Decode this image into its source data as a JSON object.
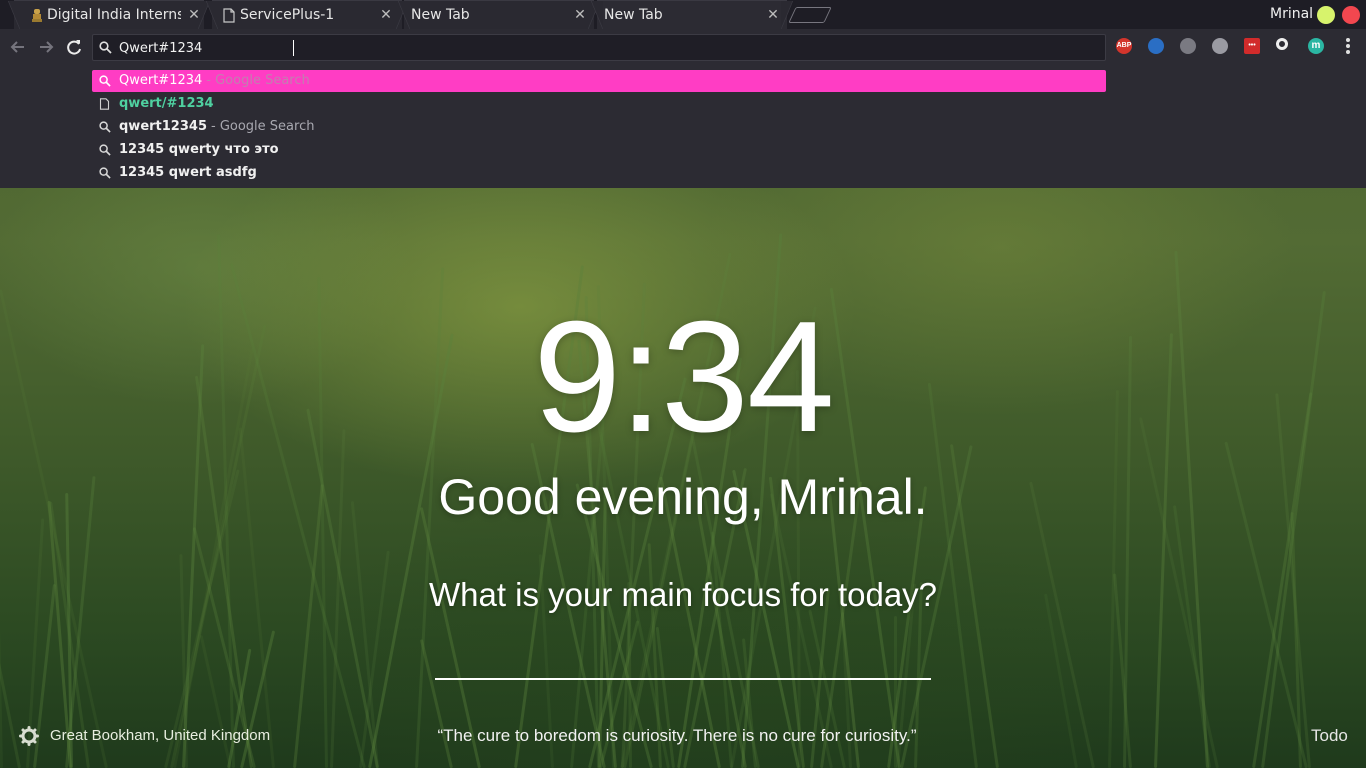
{
  "tabs": [
    {
      "title": "Digital India Interns",
      "favicon": "emblem-icon"
    },
    {
      "title": "ServicePlus-1",
      "favicon": "page-icon"
    },
    {
      "title": "New Tab",
      "favicon": ""
    },
    {
      "title": "New Tab",
      "favicon": "",
      "active": true
    }
  ],
  "tab_close_glyph": "✕",
  "profile": {
    "name": "Mrinal"
  },
  "window_buttons": [
    {
      "name": "minimize",
      "color": "#d7f36c"
    },
    {
      "name": "close",
      "color": "#f2474f"
    }
  ],
  "omnibox": {
    "value": "Qwert#1234"
  },
  "extensions": [
    {
      "name": "adblock-plus-icon",
      "label": "ABP",
      "color": "#d3352c"
    },
    {
      "name": "extension-blue-icon",
      "label": "",
      "color": "#2a6ec4"
    },
    {
      "name": "extension-hat-icon",
      "label": "",
      "color": "#7a7a82"
    },
    {
      "name": "extension-layers-icon",
      "label": "",
      "color": "#9a9aa2"
    },
    {
      "name": "lastpass-icon",
      "label": "•••",
      "color": "#d22b2b"
    },
    {
      "name": "extension-chicken-icon",
      "label": "",
      "color": "#eeeeee"
    },
    {
      "name": "momentum-icon",
      "label": "m",
      "color": "#2bb6a3"
    }
  ],
  "suggestions": [
    {
      "icon": "search-icon",
      "text": "Qwert#1234",
      "suffix": "- Google Search",
      "selected": true
    },
    {
      "icon": "page-icon",
      "text": "qwert/#1234",
      "suffix": "",
      "url": true
    },
    {
      "icon": "search-icon",
      "text": "qwert12345",
      "suffix": "- Google Search"
    },
    {
      "icon": "search-icon",
      "text": "12345 qwerty что это",
      "suffix": ""
    },
    {
      "icon": "search-icon",
      "text": "12345 qwert asdfg",
      "suffix": ""
    }
  ],
  "momentum": {
    "time": "9:34",
    "greeting": "Good evening, Mrinal.",
    "focus_question": "What is your main focus for today?",
    "location": "Great Bookham, United Kingdom",
    "quote": "“The cure to boredom is curiosity. There is no cure for curiosity.”",
    "todo_label": "Todo"
  },
  "colors": {
    "accent": "#ff3dc4",
    "url_green": "#4fd0a0"
  }
}
